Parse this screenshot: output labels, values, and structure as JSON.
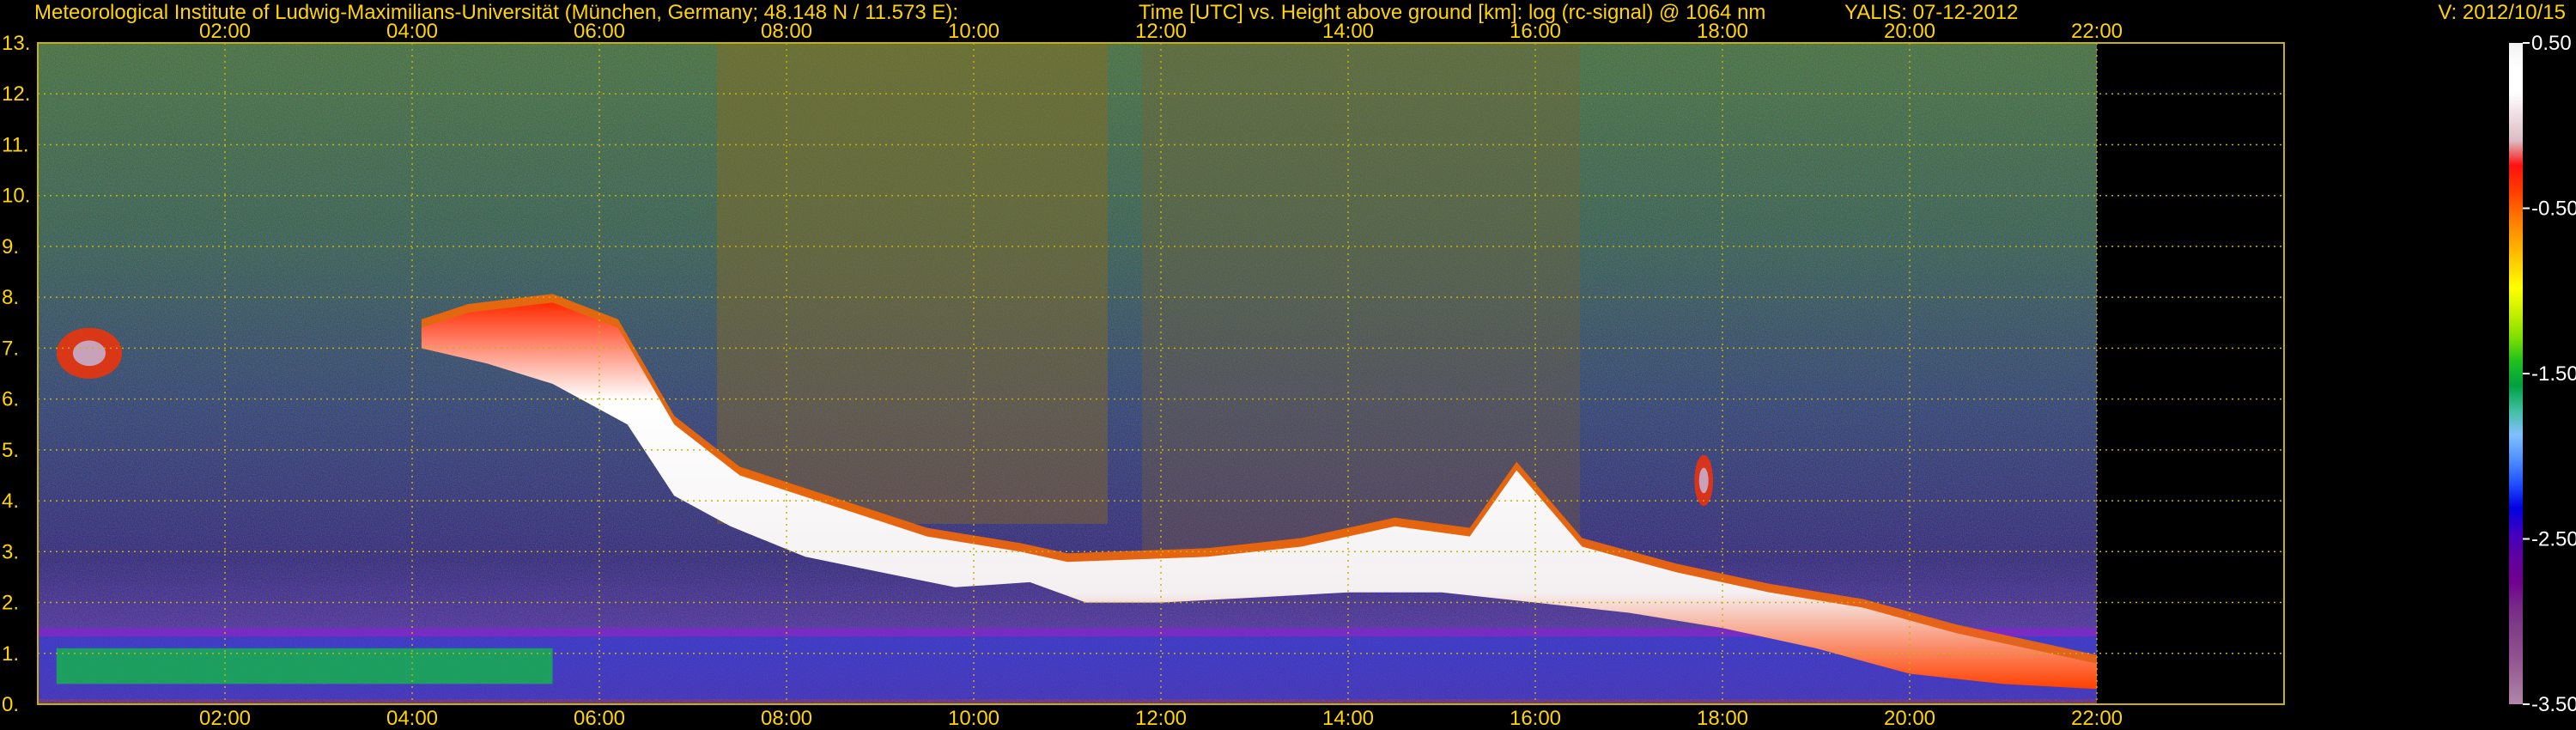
{
  "header": {
    "institute": "Meteorological Institute of Ludwig-Maximilians-Universität (München, Germany; 48.148 N / 11.573 E):",
    "plot_description": "Time [UTC] vs. Height above ground [km]: log (rc-signal) @ 1064 nm",
    "instrument_date": "YALIS: 07-12-2012",
    "version": "V: 2012/10/15"
  },
  "colors": {
    "text": "#ffd400",
    "grid": "#c8b400",
    "background": "#000000"
  },
  "chart_data": {
    "type": "heatmap",
    "title": "Time [UTC] vs. Height above ground [km]: log (rc-signal) @ 1064 nm",
    "xlabel": "",
    "ylabel": "",
    "x_ticks": [
      "02:00",
      "04:00",
      "06:00",
      "08:00",
      "10:00",
      "12:00",
      "14:00",
      "16:00",
      "18:00",
      "20:00",
      "22:00"
    ],
    "x_tick_hours": [
      2,
      4,
      6,
      8,
      10,
      12,
      14,
      16,
      18,
      20,
      22
    ],
    "xlim_hours": [
      0,
      24
    ],
    "data_end_hours": 22,
    "y_ticks": [
      "0.",
      "1.",
      "2.",
      "3.",
      "4.",
      "5.",
      "6.",
      "7.",
      "8.",
      "9.",
      "10.",
      "11.",
      "12.",
      "13."
    ],
    "ylim_km": [
      0,
      13
    ],
    "grid": true,
    "colorbar": {
      "range": [
        -3.5,
        0.5
      ],
      "ticks": [
        "0.50",
        "-0.50",
        "-1.50",
        "-2.50",
        "-3.50"
      ],
      "tick_values": [
        0.5,
        -0.5,
        -1.5,
        -2.5,
        -3.5
      ],
      "colors": [
        "#f2f2f2",
        "#ffffff",
        "#ffffff",
        "#eedde2",
        "#dcbcc4",
        "#ff1010",
        "#ff3a00",
        "#ff7000",
        "#ffa000",
        "#ffd000",
        "#ffff00",
        "#c8f000",
        "#80e000",
        "#20c020",
        "#00a040",
        "#40c0a0",
        "#80c0ff",
        "#5090ff",
        "#2050ff",
        "#0000e0",
        "#4000c0",
        "#6000a0",
        "#700090",
        "#782888",
        "#804088",
        "#905090",
        "#a06a9a",
        "#b088aa"
      ]
    },
    "features": [
      {
        "name": "aerosol layer",
        "hours": [
          0.0,
          22.0
        ],
        "height_km": [
          0.1,
          1.5
        ],
        "level": -2.0
      },
      {
        "name": "cirrus / cloud band",
        "hours": [
          4.1,
          22.0
        ],
        "height_km": [
          0.4,
          7.8
        ],
        "level": 0.2
      },
      {
        "name": "small cloud",
        "hours": [
          0.2,
          0.9
        ],
        "height_km": [
          6.4,
          7.4
        ],
        "level": -0.6
      },
      {
        "name": "small cloud",
        "hours": [
          17.7,
          17.9
        ],
        "height_km": [
          3.9,
          4.9
        ],
        "level": -0.8
      }
    ]
  }
}
